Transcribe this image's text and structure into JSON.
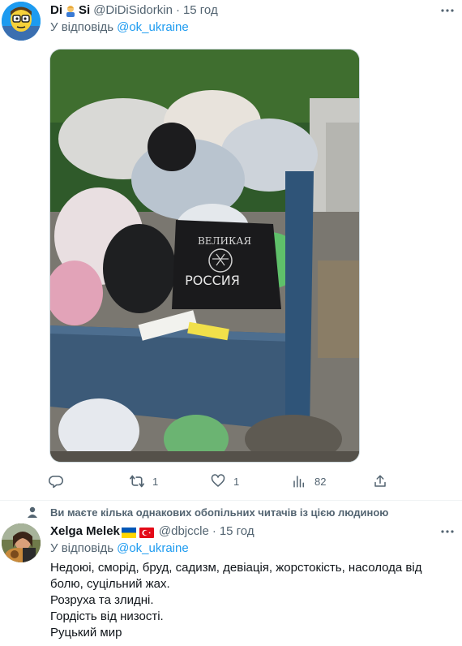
{
  "tweet1": {
    "author_name": "Di",
    "author_name_suffix": "Si",
    "handle": "@DiDiSidorkin",
    "time": "15 год",
    "reply_prefix": "У відповідь",
    "reply_handle": "@ok_ukraine",
    "image_alt_texts": [
      "ВЕЛИКАЯ",
      "РОССИЯ"
    ],
    "actions": {
      "reply_count": "",
      "retweet_count": "1",
      "like_count": "1",
      "views_count": "82"
    },
    "icons": [
      "reply-icon",
      "retweet-icon",
      "heart-icon",
      "analytics-icon",
      "share-icon",
      "more-icon"
    ]
  },
  "social_context": "Ви маєте кілька однакових обопільних читачів із цією людиною",
  "tweet2": {
    "author_name": "Xelga Melek",
    "handle": "@dbjccle",
    "time": "15 год",
    "reply_prefix": "У відповідь",
    "reply_handle": "@ok_ukraine",
    "lines": [
      "Недоюі, сморід, бруд, садизм, девіація, жорстокість, насолода від болю, суцільний жах.",
      "Розруха та злидні.",
      "Гордість від низості.",
      "Руцький мир"
    ]
  },
  "colors": {
    "link": "#1d9bf0",
    "secondary_text": "#536471",
    "primary_text": "#0f1419",
    "ukraine_blue": "#0057b7",
    "ukraine_yellow": "#ffd700",
    "turkey_red": "#e30a17"
  }
}
